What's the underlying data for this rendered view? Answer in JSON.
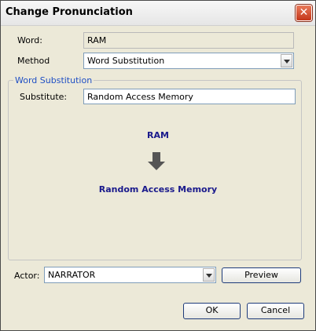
{
  "window": {
    "title": "Change Pronunciation"
  },
  "icons": {
    "close": "close-icon",
    "dropdown": "chevron-down-icon",
    "arrow": "arrow-down-icon"
  },
  "colors": {
    "group_title": "#1f4fc4",
    "preview_text": "#1a1a8c",
    "close_button": "#c4361a"
  },
  "form": {
    "word_label": "Word:",
    "word_value": "RAM",
    "method_label": "Method",
    "method_value": "Word Substitution"
  },
  "group": {
    "title": "Word Substitution",
    "substitute_label": "Substitute:",
    "substitute_value": "Random Access Memory"
  },
  "preview": {
    "original": "RAM",
    "replacement": "Random Access Memory"
  },
  "actor": {
    "label": "Actor:",
    "value": "NARRATOR",
    "preview_button": "Preview"
  },
  "buttons": {
    "ok": "OK",
    "cancel": "Cancel"
  }
}
